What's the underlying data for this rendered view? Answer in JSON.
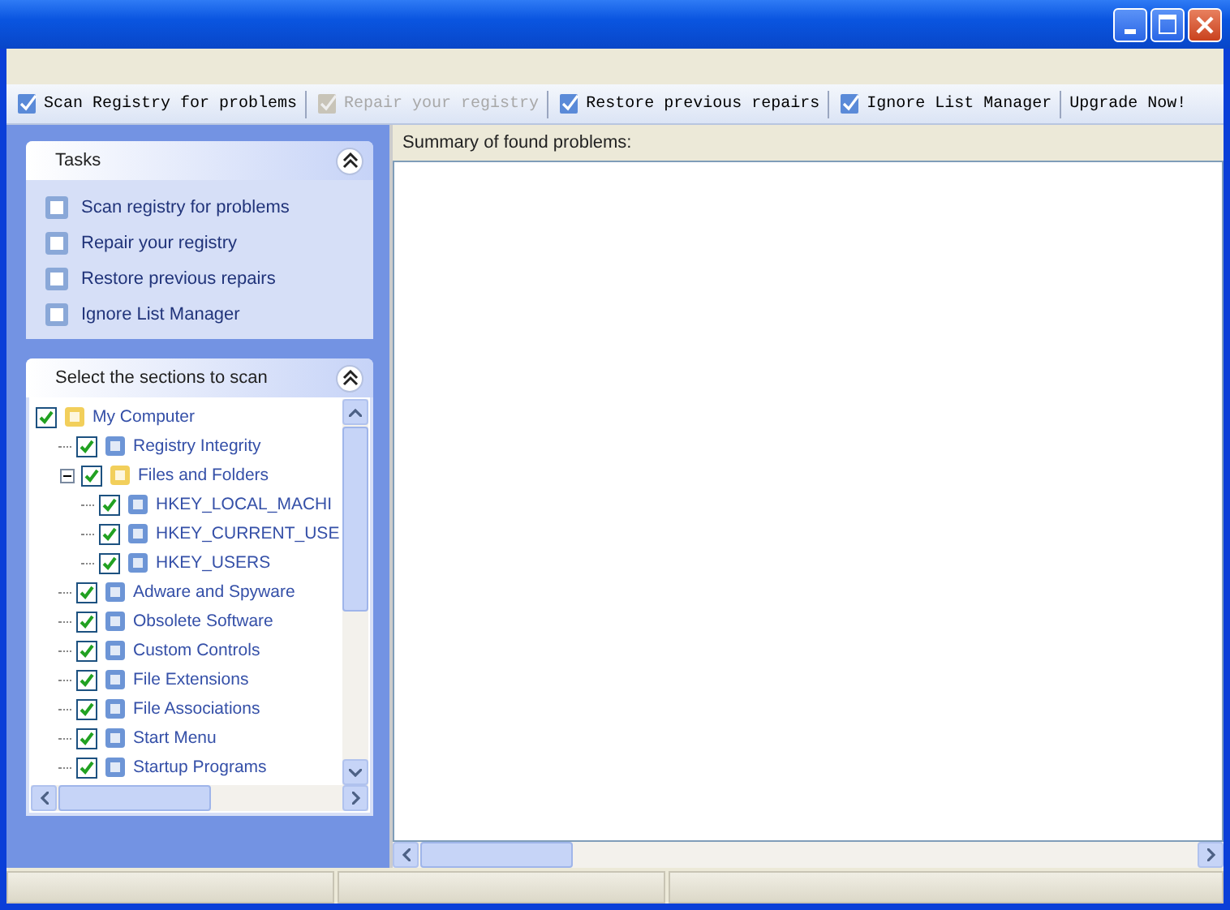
{
  "toolbar": [
    {
      "label": "Scan Registry for problems",
      "disabled": false
    },
    {
      "label": "Repair your registry",
      "disabled": true
    },
    {
      "label": "Restore previous repairs",
      "disabled": false
    },
    {
      "label": "Ignore List Manager",
      "disabled": false
    },
    {
      "label": "Upgrade Now!",
      "disabled": false
    }
  ],
  "tasks": {
    "title": "Tasks",
    "expanded": true,
    "items": [
      {
        "label": "Scan registry for problems"
      },
      {
        "label": "Repair your registry"
      },
      {
        "label": "Restore previous repairs"
      },
      {
        "label": "Ignore List Manager"
      }
    ]
  },
  "sections": {
    "title": "Select the sections to scan",
    "expanded": true,
    "tree": [
      {
        "label": "My Computer",
        "checked": true,
        "children": [
          {
            "label": "Registry Integrity",
            "checked": true
          },
          {
            "label": "Files and Folders",
            "checked": true,
            "expanded": true,
            "children": [
              {
                "label": "HKEY_LOCAL_MACHI",
                "checked": true
              },
              {
                "label": "HKEY_CURRENT_USE",
                "checked": true
              },
              {
                "label": "HKEY_USERS",
                "checked": true
              }
            ]
          },
          {
            "label": "Adware and Spyware",
            "checked": true
          },
          {
            "label": "Obsolete Software",
            "checked": true
          },
          {
            "label": "Custom Controls",
            "checked": true
          },
          {
            "label": "File Extensions",
            "checked": true
          },
          {
            "label": "File Associations",
            "checked": true
          },
          {
            "label": "Start Menu",
            "checked": true
          },
          {
            "label": "Startup Programs",
            "checked": true
          }
        ]
      }
    ]
  },
  "summary": {
    "title": "Summary of found problems:"
  }
}
